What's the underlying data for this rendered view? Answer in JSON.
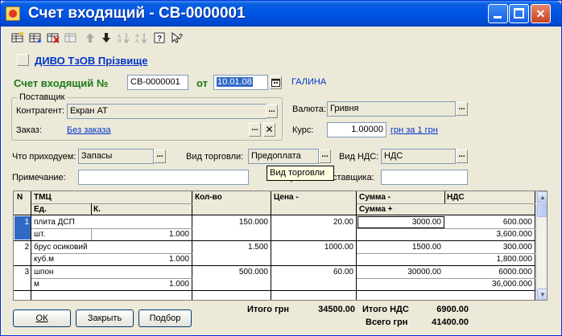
{
  "window": {
    "title": "Счет входящий - СВ-0000001",
    "minimize_glyph": "_",
    "maximize_glyph": "□",
    "close_glyph": "✕"
  },
  "toolbar": {
    "icons": [
      "new-row-icon",
      "copy-row-icon",
      "delete-row-icon",
      "edit-row-icon",
      "move-up-icon",
      "move-down-icon",
      "sort-asc-icon",
      "sort-desc-icon",
      "help-icon",
      "help-pointer-icon"
    ]
  },
  "header": {
    "organization": "ДИВО ТзОВ Прізвище",
    "doc_label": "Счет входящий №",
    "doc_number": "СВ-0000001",
    "date_label": "от",
    "date_value": "10.01.08",
    "user": "ГАЛИНА"
  },
  "supplier": {
    "group_title": "Поставщик",
    "contractor_label": "Контрагент:",
    "contractor_value": "Екран АТ",
    "order_label": "Заказ:",
    "order_value": "Без заказа"
  },
  "currency": {
    "label": "Валюта:",
    "value": "Гривня",
    "rate_label": "Курс:",
    "rate_value": "1.00000",
    "rate_unit": "грн за 1 грн"
  },
  "options": {
    "incoming_label": "Что приходуем:",
    "incoming_value": "Запасы",
    "trade_label": "Вид торговли:",
    "trade_value": "Предоплата",
    "vat_label": "Вид НДС:",
    "vat_value": "НДС",
    "note_label": "Примечание:",
    "note_value": "",
    "supplier_no_label": "Номер счета поставщика:",
    "supplier_no_value": ""
  },
  "tooltip": "Вид торговли",
  "table": {
    "headers": {
      "n": "N",
      "tmc": "ТМЦ",
      "unit": "Ед.",
      "k": "К.",
      "qty": "Кол-во",
      "price": "Цена -",
      "sum": "Сумма -",
      "vat": "НДС",
      "sum_plus": "Сумма +"
    },
    "rows": [
      {
        "n": "1",
        "name": "плита ДСП",
        "unit": "шт.",
        "k": "1.000",
        "qty": "150.000",
        "price": "20.00",
        "sum": "3000.00",
        "vat": "600.000",
        "sum_plus": "3,600.000"
      },
      {
        "n": "2",
        "name": "брус осиковий",
        "unit": "куб.м",
        "k": "1.000",
        "qty": "1.500",
        "price": "1000.00",
        "sum": "1500.00",
        "vat": "300.000",
        "sum_plus": "1,800.000"
      },
      {
        "n": "3",
        "name": "шпон",
        "unit": "м",
        "k": "1.000",
        "qty": "500.000",
        "price": "60.00",
        "sum": "30000.00",
        "vat": "6000.000",
        "sum_plus": "36,000.000"
      }
    ]
  },
  "footer": {
    "ok": "ОК",
    "close": "Закрыть",
    "select": "Подбор",
    "total_label": "Итого грн",
    "total_value": "34500.00",
    "vat_total_label": "Итого НДС",
    "vat_total_value": "6900.00",
    "grand_total_label": "Всего грн",
    "grand_total_value": "41400.00"
  }
}
